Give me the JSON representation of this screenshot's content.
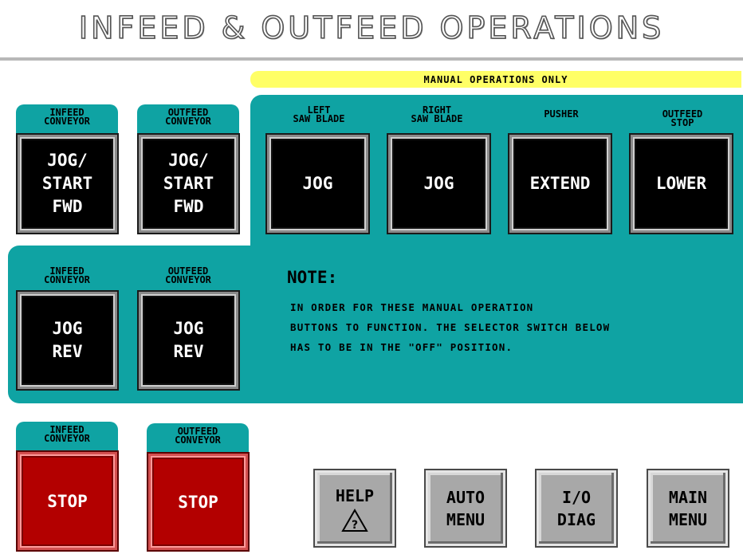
{
  "header": {
    "title": "INFEED & OUTFEED OPERATIONS"
  },
  "manual_banner": "MANUAL OPERATIONS ONLY",
  "forward_jog": [
    {
      "label_1": "INFEED",
      "label_2": "CONVEYOR",
      "btn": [
        "JOG/",
        "START",
        "FWD"
      ]
    },
    {
      "label_1": "OUTFEED",
      "label_2": "CONVEYOR",
      "btn": [
        "JOG/",
        "START",
        "FWD"
      ]
    }
  ],
  "manual_ops": [
    {
      "label_1": "LEFT",
      "label_2": "SAW BLADE",
      "btn": "JOG"
    },
    {
      "label_1": "RIGHT",
      "label_2": "SAW BLADE",
      "btn": "JOG"
    },
    {
      "label_1": "PUSHER",
      "label_2": "",
      "btn": "EXTEND"
    },
    {
      "label_1": "OUTFEED",
      "label_2": "STOP",
      "btn": "LOWER"
    }
  ],
  "reverse_jog": [
    {
      "label_1": "INFEED",
      "label_2": "CONVEYOR",
      "btn": [
        "JOG",
        "REV"
      ]
    },
    {
      "label_1": "OUTFEED",
      "label_2": "CONVEYOR",
      "btn": [
        "JOG",
        "REV"
      ]
    }
  ],
  "note": {
    "title": "NOTE:",
    "lines": [
      "IN ORDER FOR THESE MANUAL OPERATION",
      "BUTTONS TO FUNCTION. THE SELECTOR SWITCH BELOW",
      "HAS TO BE IN THE \"OFF\" POSITION."
    ]
  },
  "stop_buttons": [
    {
      "label_1": "INFEED",
      "label_2": "CONVEYOR",
      "btn": "STOP"
    },
    {
      "label_1": "OUTFEED",
      "label_2": "CONVEYOR",
      "btn": "STOP"
    }
  ],
  "nav": {
    "help": "HELP",
    "auto": [
      "AUTO",
      "MENU"
    ],
    "io": [
      "I/O",
      "DIAG"
    ],
    "main": [
      "MAIN",
      "MENU"
    ]
  },
  "colors": {
    "teal": "#0fa3a3",
    "banner": "#ffff66",
    "stop": "#b30000",
    "nav": "#a8a8a8"
  }
}
